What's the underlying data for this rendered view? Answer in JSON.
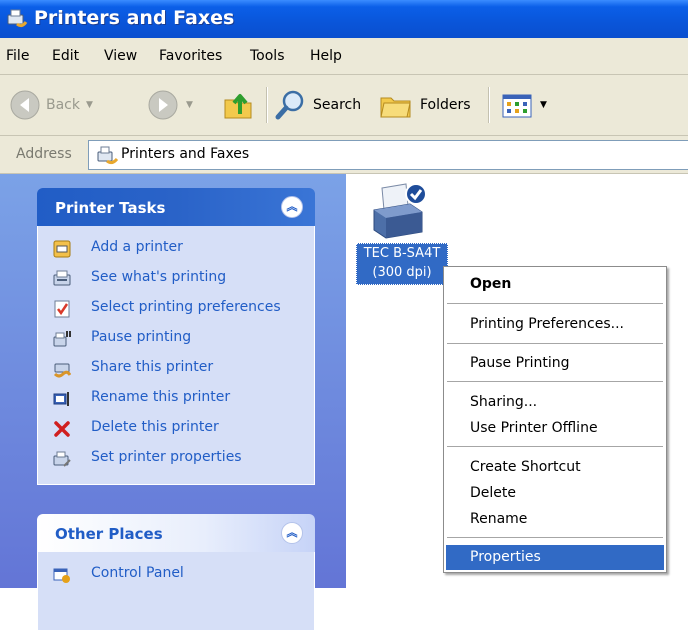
{
  "window": {
    "title": "Printers and Faxes"
  },
  "menu": [
    "File",
    "Edit",
    "View",
    "Favorites",
    "Tools",
    "Help"
  ],
  "toolbar": {
    "back_label": "Back",
    "search_label": "Search",
    "folders_label": "Folders"
  },
  "address": {
    "label": "Address",
    "value": "Printers and Faxes"
  },
  "printer_tasks": {
    "title": "Printer Tasks",
    "items": [
      {
        "label": "Add a printer",
        "icon": "add-printer-icon"
      },
      {
        "label": "See what's printing",
        "icon": "print-queue-icon"
      },
      {
        "label": "Select printing preferences",
        "icon": "preferences-icon"
      },
      {
        "label": "Pause printing",
        "icon": "pause-printer-icon"
      },
      {
        "label": "Share this printer",
        "icon": "share-printer-icon"
      },
      {
        "label": "Rename this printer",
        "icon": "rename-icon"
      },
      {
        "label": "Delete this printer",
        "icon": "delete-x-icon"
      },
      {
        "label": "Set printer properties",
        "icon": "printer-properties-icon"
      }
    ]
  },
  "other_places": {
    "title": "Other Places",
    "items": [
      {
        "label": "Control Panel",
        "icon": "control-panel-icon"
      }
    ]
  },
  "printer": {
    "name_line1": "TEC B-SA4T",
    "name_line2": "(300 dpi)"
  },
  "context_menu": {
    "open": "Open",
    "printing_preferences": "Printing Preferences...",
    "pause_printing": "Pause Printing",
    "sharing": "Sharing...",
    "use_offline": "Use Printer Offline",
    "create_shortcut": "Create Shortcut",
    "delete": "Delete",
    "rename": "Rename",
    "properties": "Properties"
  },
  "colors": {
    "title_bar": "#0a55d9",
    "chrome": "#ece9d8",
    "task_link": "#215dc6",
    "selection": "#316ac5"
  }
}
